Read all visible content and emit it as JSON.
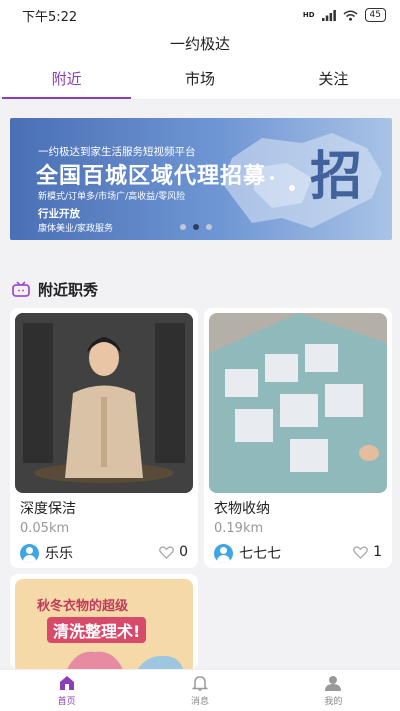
{
  "status_bar": {
    "time": "下午5:22",
    "network": "HD",
    "battery": "45"
  },
  "app": {
    "title": "一约极达"
  },
  "tabs": [
    {
      "label": "附近",
      "active": true
    },
    {
      "label": "市场",
      "active": false
    },
    {
      "label": "关注",
      "active": false
    }
  ],
  "banner": {
    "line1": "一约极达到家生活服务短视频平台",
    "line2": "全国百城区域代理招募",
    "line3": "新模式/订单多/市场广/高收益/零风险",
    "line4": "行业开放",
    "line5": "康体美业/家政服务",
    "big_char": "招",
    "page_count": 3,
    "active_page": 2
  },
  "section": {
    "title": "附近职秀",
    "icon": "tv-icon"
  },
  "cards": [
    {
      "title": "深度保洁",
      "distance": "0.05km",
      "user": "乐乐",
      "likes": "0"
    },
    {
      "title": "衣物收纳",
      "distance": "0.19km",
      "user": "七七七",
      "likes": "1"
    },
    {
      "image_text_line1": "秋冬衣物的超级",
      "image_text_line2": "清洗整理术!"
    }
  ],
  "bottom_nav": [
    {
      "label": "首页",
      "icon": "home-icon",
      "active": true
    },
    {
      "label": "消息",
      "icon": "bell-icon",
      "active": false
    },
    {
      "label": "我的",
      "icon": "user-icon",
      "active": false
    }
  ],
  "colors": {
    "accent": "#8a3fb5",
    "avatar": "#3ea6e4"
  }
}
